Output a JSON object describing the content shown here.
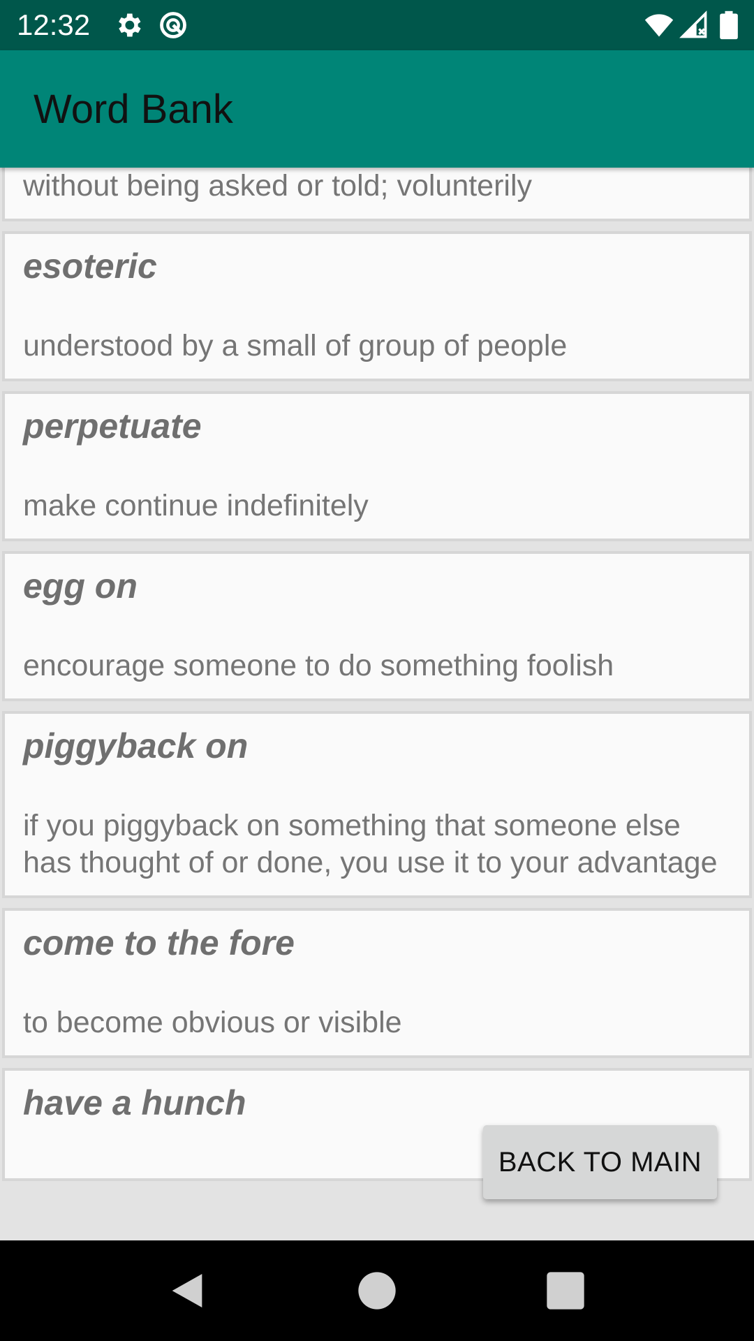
{
  "status_bar": {
    "time": "12:32",
    "icons": [
      "gear-icon",
      "sync-icon",
      "wifi-icon",
      "signal-icon",
      "battery-icon"
    ]
  },
  "app_bar": {
    "title": "Word Bank"
  },
  "words": [
    {
      "term": "",
      "definition": "without being asked or told; volunterily"
    },
    {
      "term": "esoteric",
      "definition": "understood by a small of group of people"
    },
    {
      "term": "perpetuate",
      "definition": "make continue indefinitely"
    },
    {
      "term": "egg on",
      "definition": "encourage someone to do something foolish"
    },
    {
      "term": "piggyback on",
      "definition": "if you piggyback on something that someone else has thought of or done, you use it to your advantage"
    },
    {
      "term": "come to the fore",
      "definition": "to become obvious or visible"
    },
    {
      "term": "have a hunch",
      "definition": ""
    }
  ],
  "back_button": {
    "label": "BACK TO MAIN"
  },
  "nav_bar": {
    "icons": [
      "back-icon",
      "home-icon",
      "recents-icon"
    ]
  },
  "colors": {
    "status_bar": "#00574b",
    "app_bar": "#008577",
    "card_background": "#fafafa",
    "card_border": "#d6d6d6",
    "term_text": "#6f6f6f",
    "definition_text": "#757575",
    "button_background": "#d6d7d7"
  }
}
